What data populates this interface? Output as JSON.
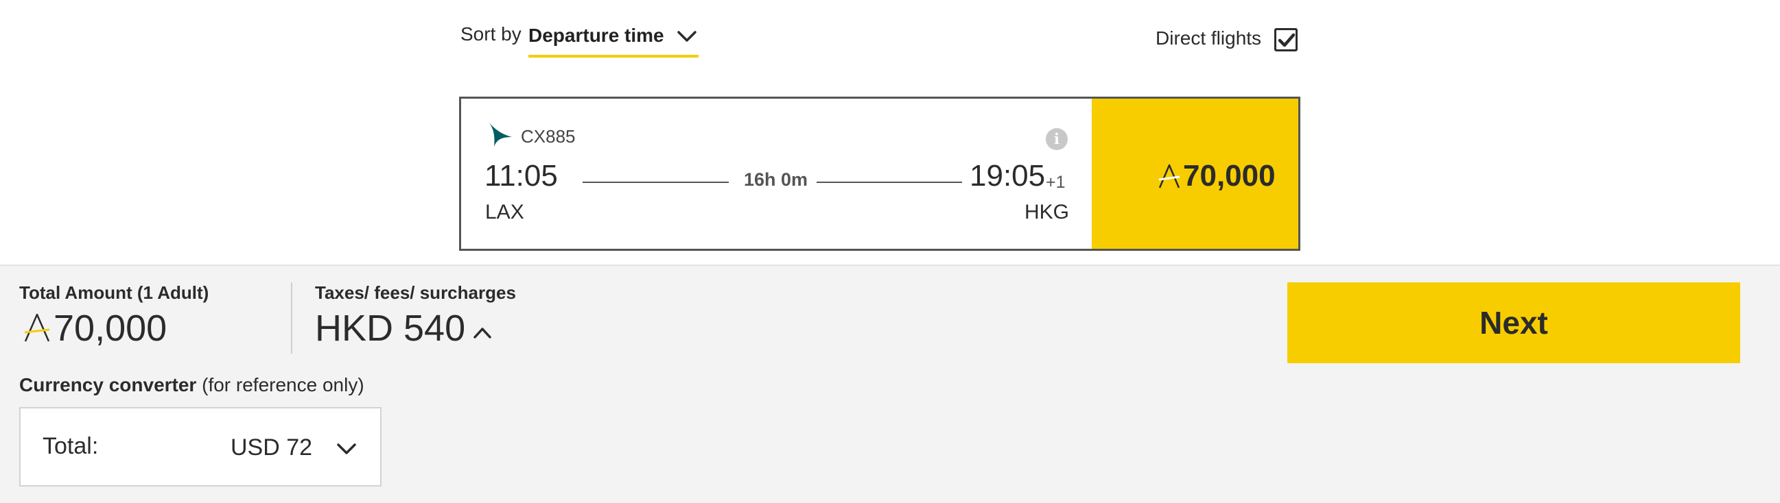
{
  "sort": {
    "label": "Sort by",
    "selected": "Departure time",
    "chevron_icon": "chevron-down-icon"
  },
  "filter": {
    "direct_label": "Direct flights",
    "direct_checked": true
  },
  "flight": {
    "airline_logo": "cathay-pacific-logo",
    "number": "CX885",
    "info_icon": "i",
    "departure_time": "11:05",
    "departure_airport": "LAX",
    "duration": "16h 0m",
    "arrival_time": "19:05",
    "day_offset": "+1",
    "arrival_airport": "HKG",
    "price": "70,000",
    "price_currency_icon": "avios-icon"
  },
  "summary": {
    "total_label": "Total Amount (1 Adult)",
    "total_amount": "70,000",
    "taxes_label": "Taxes/ fees/ surcharges",
    "taxes_amount": "HKD 540",
    "next_label": "Next",
    "converter_title_bold": "Currency converter",
    "converter_title_note": " (for reference only)",
    "converter_label": "Total:",
    "converter_value": "USD 72"
  },
  "colors": {
    "accent_yellow": "#f7cd00",
    "text_dark": "#2b2b2b",
    "logo_green": "#005d63",
    "panel_grey": "#f3f3f3"
  }
}
